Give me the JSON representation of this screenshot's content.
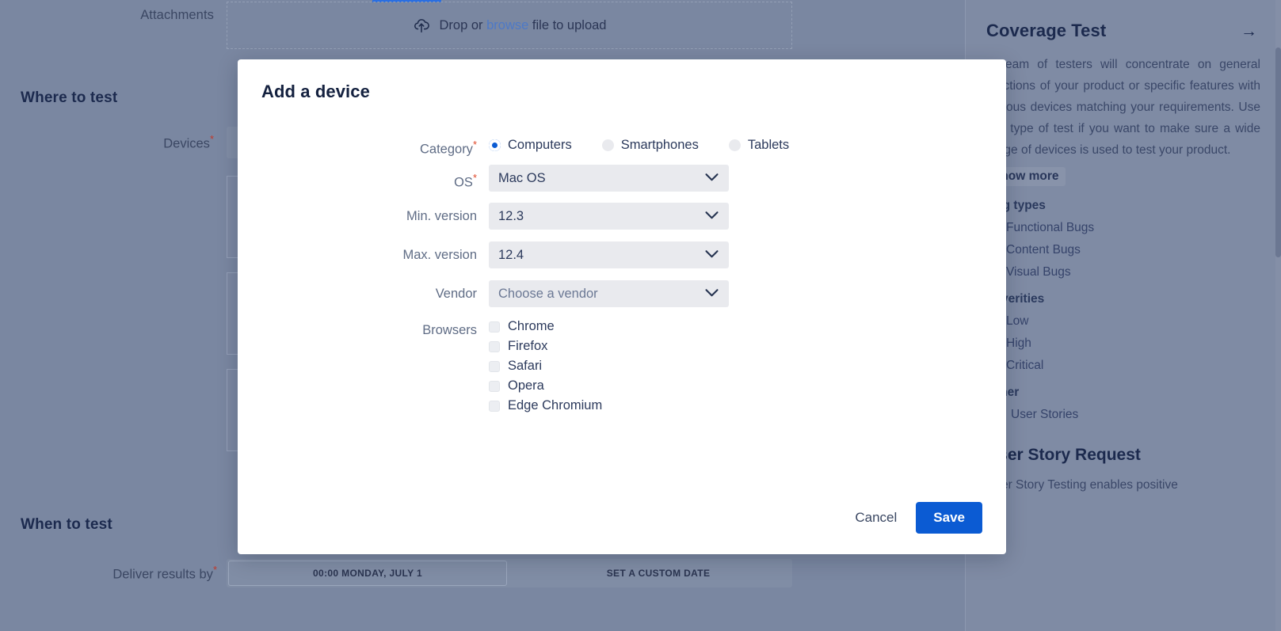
{
  "background": {
    "attachments_label": "Attachments",
    "dropzone": {
      "prefix": "Drop or ",
      "browse": "browse",
      "suffix": " file to upload",
      "icon": "cloud-upload-icon"
    },
    "where_to_test": "Where to test",
    "devices_label": "Devices",
    "when_to_test": "When to test",
    "deliver_label": "Deliver results by",
    "deliver_value": "00:00 MONDAY, JULY 1",
    "deliver_custom": "SET A CUSTOM DATE",
    "required_marker": "*"
  },
  "sidebar": {
    "title": "Coverage Test",
    "arrow_icon": "arrow-right-icon",
    "paragraph": "A team of testers will concentrate on general functions of your product or specific features with various devices matching your requirements. Use this type of test if you want to make sure a wide range of devices is used to test your product.",
    "show_more": "Show more",
    "bug_types_title": "Bug types",
    "bug_types": [
      {
        "label": "Functional Bugs",
        "color": "#c0392b"
      },
      {
        "label": "Content Bugs",
        "color": "#1b5fc4"
      },
      {
        "label": "Visual Bugs",
        "color": "#d98022"
      }
    ],
    "severities_title": "Severities",
    "severities": [
      {
        "label": "Low",
        "color": "#4a86c8"
      },
      {
        "label": "High",
        "color": "#c9b21f"
      },
      {
        "label": "Critical",
        "color": "#c0392b"
      }
    ],
    "other_title": "Other",
    "other": [
      {
        "label": "User Stories",
        "icon": "document-icon"
      }
    ],
    "subtitle": "User Story Request",
    "subparagraph": "User Story Testing enables positive"
  },
  "modal": {
    "title": "Add a device",
    "fields": {
      "category": {
        "label": "Category",
        "required": true,
        "options": [
          {
            "label": "Computers",
            "selected": true
          },
          {
            "label": "Smartphones",
            "selected": false
          },
          {
            "label": "Tablets",
            "selected": false
          }
        ]
      },
      "os": {
        "label": "OS",
        "required": true,
        "value": "Mac OS",
        "is_placeholder": false
      },
      "min_version": {
        "label": "Min. version",
        "required": false,
        "value": "12.3",
        "is_placeholder": false
      },
      "max_version": {
        "label": "Max. version",
        "required": false,
        "value": "12.4",
        "is_placeholder": false
      },
      "vendor": {
        "label": "Vendor",
        "required": false,
        "value": "Choose a vendor",
        "is_placeholder": true
      },
      "browsers": {
        "label": "Browsers",
        "required": false,
        "options": [
          {
            "label": "Chrome",
            "checked": false
          },
          {
            "label": "Firefox",
            "checked": false
          },
          {
            "label": "Safari",
            "checked": false
          },
          {
            "label": "Opera",
            "checked": false
          },
          {
            "label": "Edge Chromium",
            "checked": false
          }
        ]
      }
    },
    "cancel_label": "Cancel",
    "save_label": "Save"
  },
  "colors": {
    "accent": "#0b5bd3",
    "required": "#e0492b",
    "backdrop": "#7a87a1",
    "field_bg": "#e9eaee"
  }
}
